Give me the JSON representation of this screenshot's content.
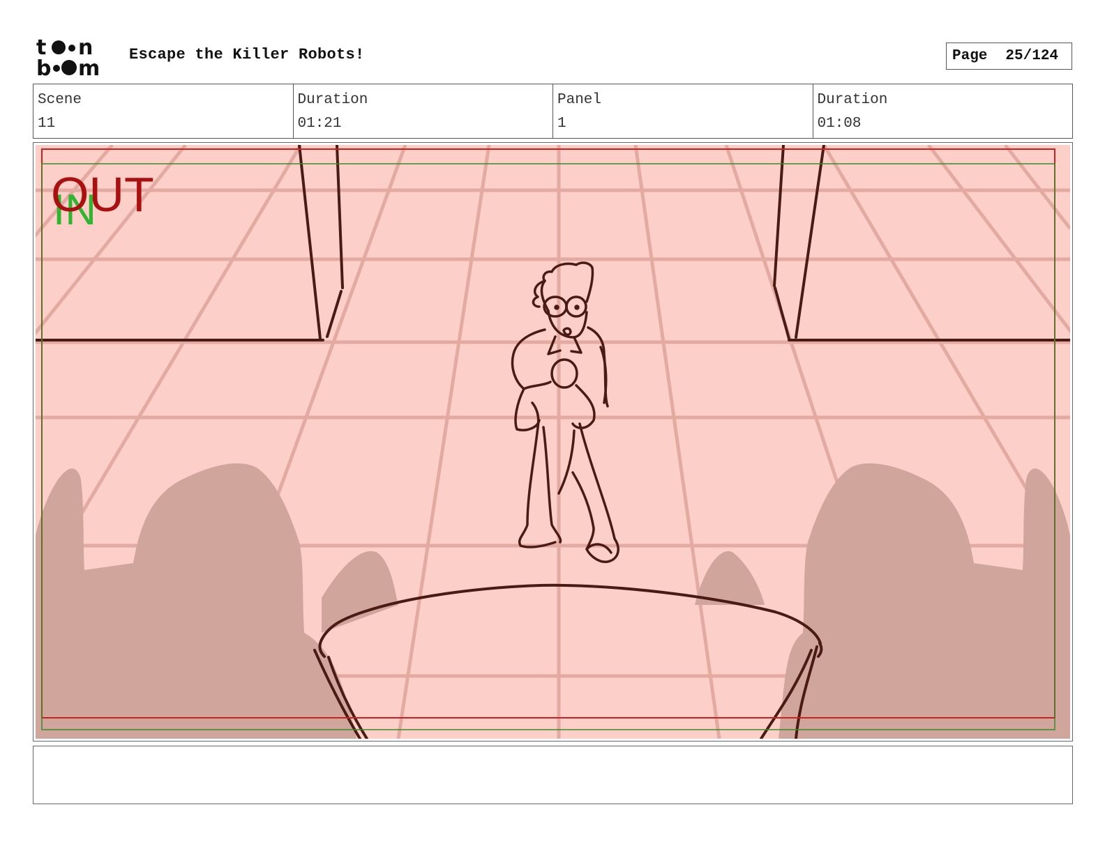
{
  "header": {
    "project_title": "Escape the Killer Robots!",
    "page_label": "Page",
    "page_value": "25/124"
  },
  "info": {
    "scene_label": "Scene",
    "scene_value": "11",
    "scene_duration_label": "Duration",
    "scene_duration_value": "01:21",
    "panel_label": "Panel",
    "panel_value": "1",
    "panel_duration_label": "Duration",
    "panel_duration_value": "01:08"
  },
  "panel": {
    "out_marker": "OUT",
    "in_marker": "IN"
  },
  "colors": {
    "panel_bg": "#fccfc8",
    "grid_line": "#e3aaa2",
    "silhouette": "#cfa59c",
    "ink": "#4a1a14",
    "safe_red": "#cc1f1f",
    "safe_green": "#3a8a2a",
    "in_green": "#2fb52f",
    "out_red": "#aa1010"
  },
  "notes": {}
}
